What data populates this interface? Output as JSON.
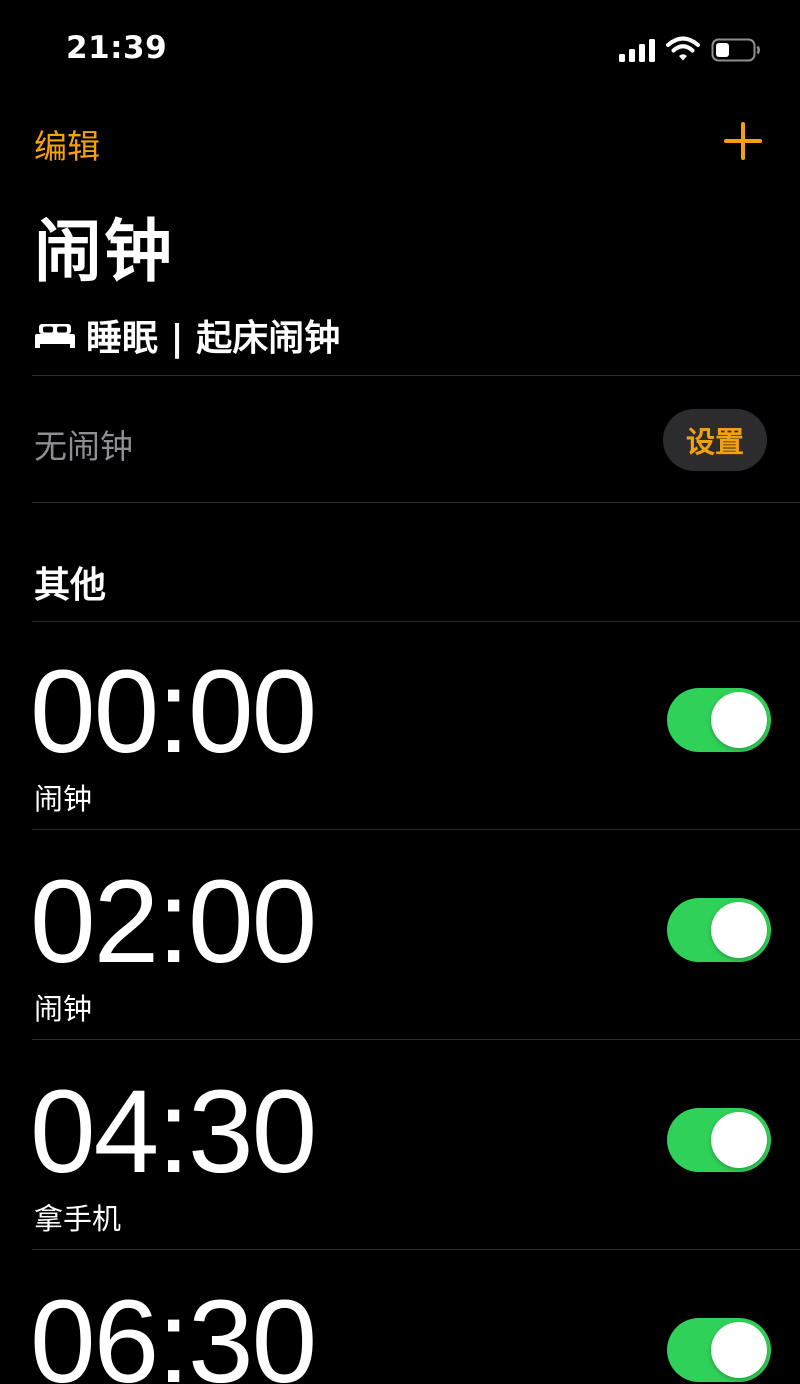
{
  "status_bar": {
    "time": "21:39"
  },
  "nav": {
    "edit_label": "编辑"
  },
  "page": {
    "title": "闹钟"
  },
  "sleep": {
    "header": "睡眠 | 起床闹钟",
    "no_alarm_text": "无闹钟",
    "setup_label": "设置"
  },
  "others": {
    "header": "其他",
    "alarms": [
      {
        "time": "00:00",
        "label": "闹钟",
        "enabled": true
      },
      {
        "time": "02:00",
        "label": "闹钟",
        "enabled": true
      },
      {
        "time": "04:30",
        "label": "拿手机",
        "enabled": true
      },
      {
        "time": "06:30",
        "label": "",
        "enabled": true
      }
    ]
  },
  "colors": {
    "accent": "#f5a00f",
    "toggle_on": "#30d158",
    "secondary_text": "#8e8e93",
    "background": "#000000"
  }
}
